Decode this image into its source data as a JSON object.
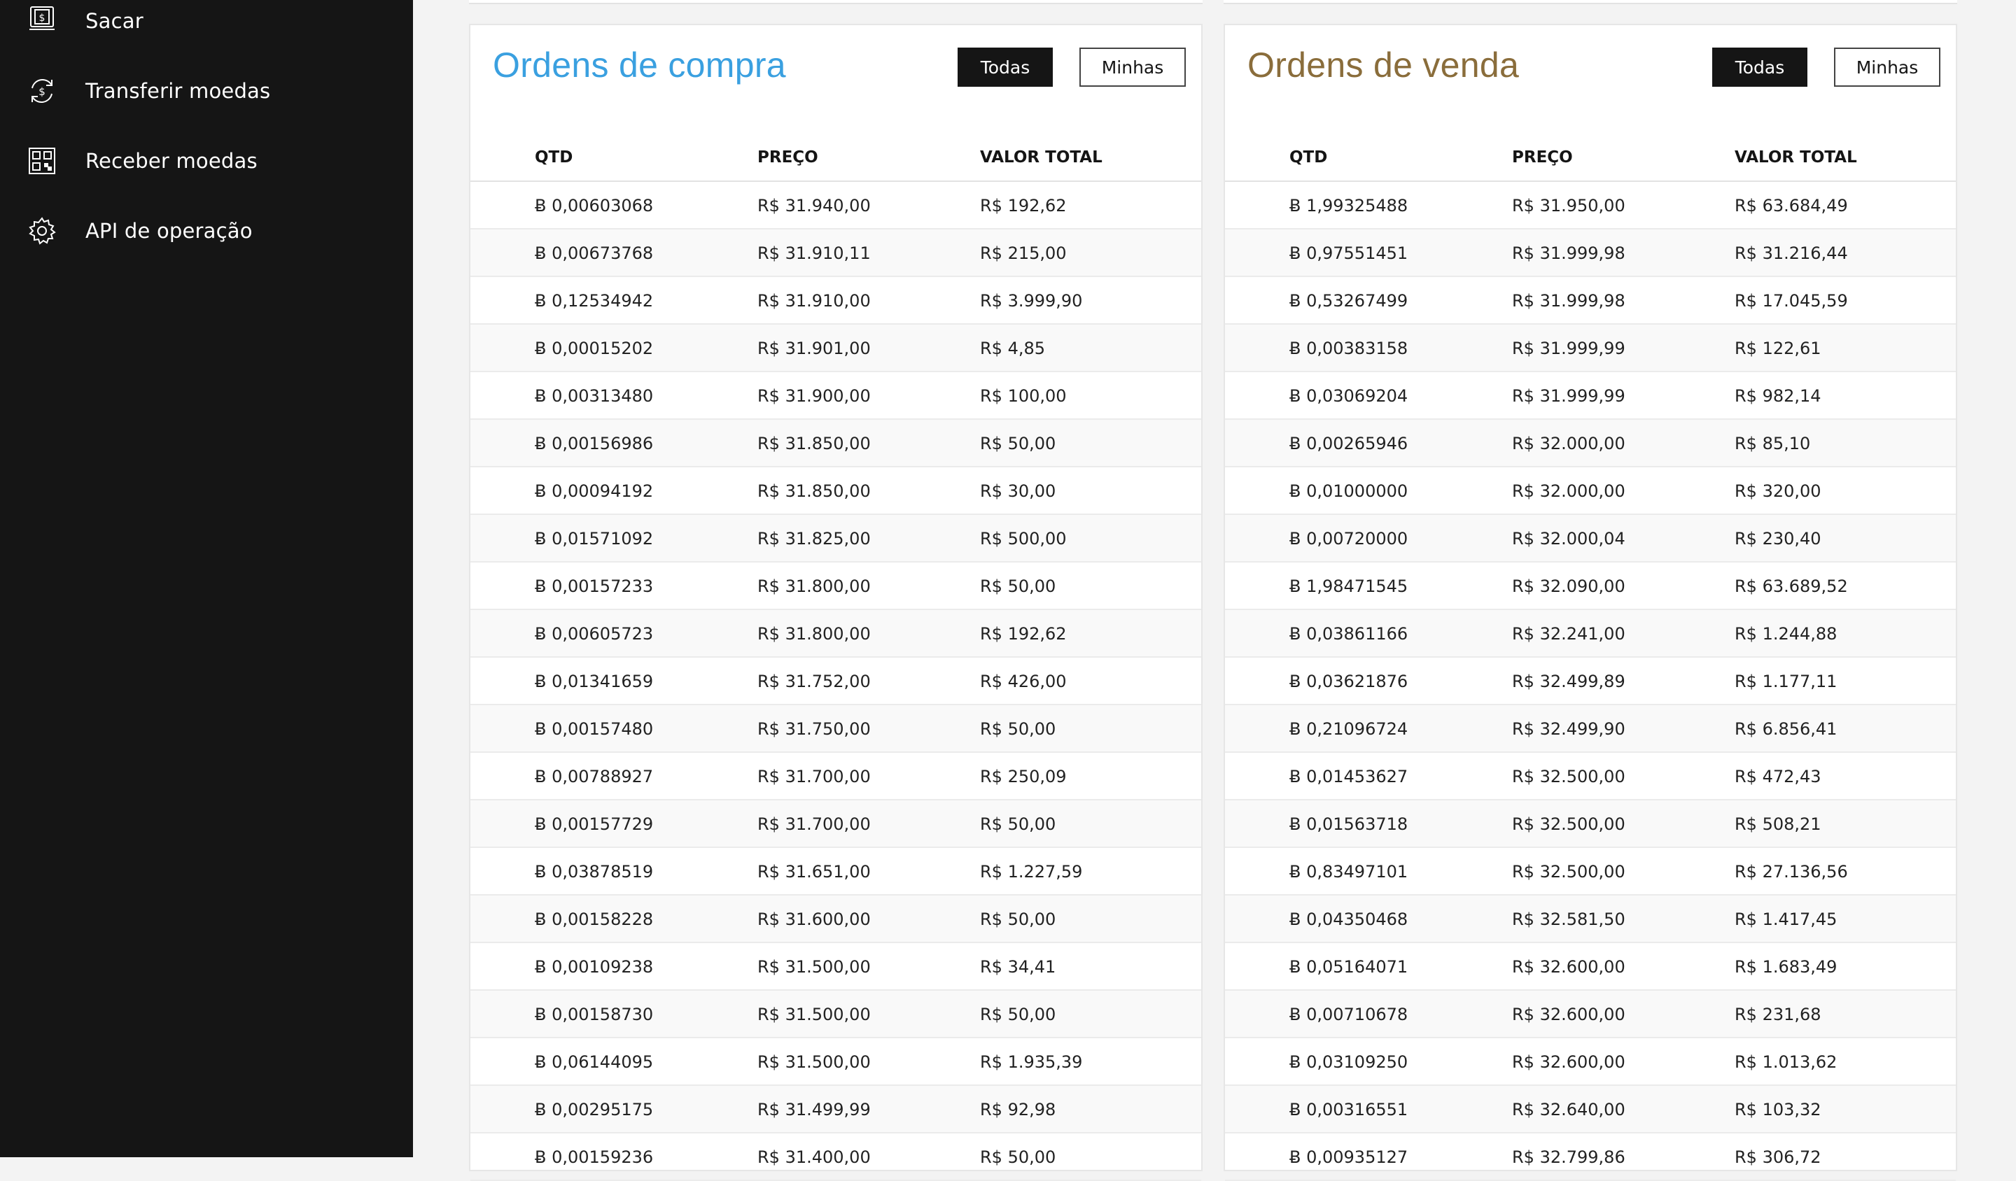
{
  "sidebar": {
    "items": [
      {
        "label": "Sacar",
        "icon": "withdraw-icon"
      },
      {
        "label": "Transferir moedas",
        "icon": "transfer-icon"
      },
      {
        "label": "Receber moedas",
        "icon": "qr-code-icon"
      },
      {
        "label": "API de operação",
        "icon": "gear-icon"
      }
    ]
  },
  "colors": {
    "sidebar_bg": "#151515",
    "buy_title": "#3aa0e0",
    "sell_title": "#8a6d3b"
  },
  "buy": {
    "title": "Ordens de compra",
    "btn_all": "Todas",
    "btn_mine": "Minhas",
    "headers": [
      "QTD",
      "PREÇO",
      "VALOR TOTAL"
    ],
    "rows": [
      [
        "Ƀ 0,00603068",
        "R$ 31.940,00",
        "R$ 192,62"
      ],
      [
        "Ƀ 0,00673768",
        "R$ 31.910,11",
        "R$ 215,00"
      ],
      [
        "Ƀ 0,12534942",
        "R$ 31.910,00",
        "R$ 3.999,90"
      ],
      [
        "Ƀ 0,00015202",
        "R$ 31.901,00",
        "R$ 4,85"
      ],
      [
        "Ƀ 0,00313480",
        "R$ 31.900,00",
        "R$ 100,00"
      ],
      [
        "Ƀ 0,00156986",
        "R$ 31.850,00",
        "R$ 50,00"
      ],
      [
        "Ƀ 0,00094192",
        "R$ 31.850,00",
        "R$ 30,00"
      ],
      [
        "Ƀ 0,01571092",
        "R$ 31.825,00",
        "R$ 500,00"
      ],
      [
        "Ƀ 0,00157233",
        "R$ 31.800,00",
        "R$ 50,00"
      ],
      [
        "Ƀ 0,00605723",
        "R$ 31.800,00",
        "R$ 192,62"
      ],
      [
        "Ƀ 0,01341659",
        "R$ 31.752,00",
        "R$ 426,00"
      ],
      [
        "Ƀ 0,00157480",
        "R$ 31.750,00",
        "R$ 50,00"
      ],
      [
        "Ƀ 0,00788927",
        "R$ 31.700,00",
        "R$ 250,09"
      ],
      [
        "Ƀ 0,00157729",
        "R$ 31.700,00",
        "R$ 50,00"
      ],
      [
        "Ƀ 0,03878519",
        "R$ 31.651,00",
        "R$ 1.227,59"
      ],
      [
        "Ƀ 0,00158228",
        "R$ 31.600,00",
        "R$ 50,00"
      ],
      [
        "Ƀ 0,00109238",
        "R$ 31.500,00",
        "R$ 34,41"
      ],
      [
        "Ƀ 0,00158730",
        "R$ 31.500,00",
        "R$ 50,00"
      ],
      [
        "Ƀ 0,06144095",
        "R$ 31.500,00",
        "R$ 1.935,39"
      ],
      [
        "Ƀ 0,00295175",
        "R$ 31.499,99",
        "R$ 92,98"
      ],
      [
        "Ƀ 0,00159236",
        "R$ 31.400,00",
        "R$ 50,00"
      ]
    ]
  },
  "sell": {
    "title": "Ordens de venda",
    "btn_all": "Todas",
    "btn_mine": "Minhas",
    "headers": [
      "QTD",
      "PREÇO",
      "VALOR TOTAL"
    ],
    "rows": [
      [
        "Ƀ 1,99325488",
        "R$ 31.950,00",
        "R$ 63.684,49"
      ],
      [
        "Ƀ 0,97551451",
        "R$ 31.999,98",
        "R$ 31.216,44"
      ],
      [
        "Ƀ 0,53267499",
        "R$ 31.999,98",
        "R$ 17.045,59"
      ],
      [
        "Ƀ 0,00383158",
        "R$ 31.999,99",
        "R$ 122,61"
      ],
      [
        "Ƀ 0,03069204",
        "R$ 31.999,99",
        "R$ 982,14"
      ],
      [
        "Ƀ 0,00265946",
        "R$ 32.000,00",
        "R$ 85,10"
      ],
      [
        "Ƀ 0,01000000",
        "R$ 32.000,00",
        "R$ 320,00"
      ],
      [
        "Ƀ 0,00720000",
        "R$ 32.000,04",
        "R$ 230,40"
      ],
      [
        "Ƀ 1,98471545",
        "R$ 32.090,00",
        "R$ 63.689,52"
      ],
      [
        "Ƀ 0,03861166",
        "R$ 32.241,00",
        "R$ 1.244,88"
      ],
      [
        "Ƀ 0,03621876",
        "R$ 32.499,89",
        "R$ 1.177,11"
      ],
      [
        "Ƀ 0,21096724",
        "R$ 32.499,90",
        "R$ 6.856,41"
      ],
      [
        "Ƀ 0,01453627",
        "R$ 32.500,00",
        "R$ 472,43"
      ],
      [
        "Ƀ 0,01563718",
        "R$ 32.500,00",
        "R$ 508,21"
      ],
      [
        "Ƀ 0,83497101",
        "R$ 32.500,00",
        "R$ 27.136,56"
      ],
      [
        "Ƀ 0,04350468",
        "R$ 32.581,50",
        "R$ 1.417,45"
      ],
      [
        "Ƀ 0,05164071",
        "R$ 32.600,00",
        "R$ 1.683,49"
      ],
      [
        "Ƀ 0,00710678",
        "R$ 32.600,00",
        "R$ 231,68"
      ],
      [
        "Ƀ 0,03109250",
        "R$ 32.600,00",
        "R$ 1.013,62"
      ],
      [
        "Ƀ 0,00316551",
        "R$ 32.640,00",
        "R$ 103,32"
      ],
      [
        "Ƀ 0,00935127",
        "R$ 32.799,86",
        "R$ 306,72"
      ]
    ]
  }
}
